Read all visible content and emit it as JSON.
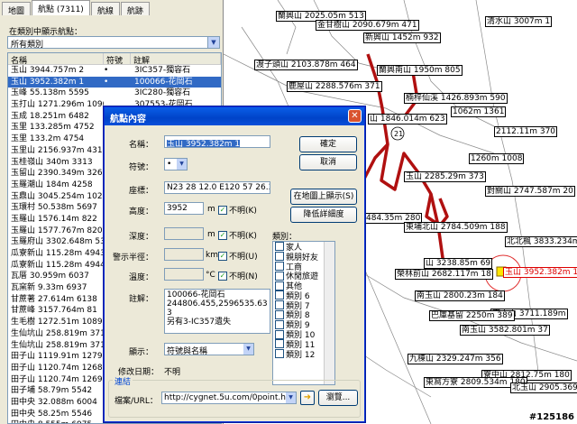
{
  "left_panel": {
    "tabs": [
      "地圖",
      "航點 (7311)",
      "航線",
      "航跡"
    ],
    "filter_label": "在類別中顯示航點：",
    "filter_value": "所有類別",
    "columns": [
      "名稱",
      "符號",
      "註解"
    ],
    "rows": [
      {
        "name": "玉山 3944.757m 2",
        "sym": "•",
        "note": "3IC357-獨容石"
      },
      {
        "name": "玉山 3952.382m 1",
        "sym": "•",
        "note": "100066-花岡石",
        "selected": true
      },
      {
        "name": "玉峰 55.138m 5595",
        "sym": "",
        "note": "3IC280-獨容石"
      },
      {
        "name": "玉打山 1271.296m 1090",
        "sym": "",
        "note": "307553-花岡石"
      },
      {
        "name": "玉成 18.251m 6482",
        "sym": "",
        "note": ""
      },
      {
        "name": "玉里 133.285m 4752",
        "sym": "",
        "note": ""
      },
      {
        "name": "玉里 133.2m 4754",
        "sym": "",
        "note": ""
      },
      {
        "name": "玉里山 2156.937m 431",
        "sym": "",
        "note": ""
      },
      {
        "name": "玉桂嶺山 340m 3313",
        "sym": "",
        "note": ""
      },
      {
        "name": "玉留山 2390.349m 326",
        "sym": "",
        "note": ""
      },
      {
        "name": "玉羅潮山 184m 4258",
        "sym": "",
        "note": ""
      },
      {
        "name": "玉鼎山 3045.254m 102",
        "sym": "",
        "note": ""
      },
      {
        "name": "玉環村 50.538m 5697",
        "sym": "",
        "note": ""
      },
      {
        "name": "玉羅山 1576.14m 822",
        "sym": "",
        "note": ""
      },
      {
        "name": "玉羅山 1577.767m 820",
        "sym": "",
        "note": ""
      },
      {
        "name": "玉羅府山 3302.648m 53",
        "sym": "",
        "note": ""
      },
      {
        "name": "瓜寮新山 115.28m 4943",
        "sym": "",
        "note": ""
      },
      {
        "name": "瓜寮新山 115.28m 4944",
        "sym": "",
        "note": ""
      },
      {
        "name": "瓦厝 30.959m 6037",
        "sym": "",
        "note": ""
      },
      {
        "name": "瓦窯新 9.33m 6937",
        "sym": "",
        "note": ""
      },
      {
        "name": "甘蔗著 27.614m 6138",
        "sym": "",
        "note": ""
      },
      {
        "name": "甘蔗峰 3157.764m 81",
        "sym": "",
        "note": ""
      },
      {
        "name": "生毛樹 1272.51m 1089",
        "sym": "",
        "note": ""
      },
      {
        "name": "生仙坑山 258.819m 3713",
        "sym": "",
        "note": ""
      },
      {
        "name": "生仙坑山 258.819m 3714",
        "sym": "",
        "note": ""
      },
      {
        "name": "田子山 1119.91m 1279",
        "sym": "",
        "note": ""
      },
      {
        "name": "田子山 1120.74m 1268",
        "sym": "",
        "note": ""
      },
      {
        "name": "田子山 1120.74m 1269",
        "sym": "",
        "note": ""
      },
      {
        "name": "田子埔 58.79m 5542",
        "sym": "",
        "note": ""
      },
      {
        "name": "田中央 32.088m 6004",
        "sym": "",
        "note": ""
      },
      {
        "name": "田中央 58.25m 5546",
        "sym": "",
        "note": ""
      },
      {
        "name": "田中央 8.555m 6975",
        "sym": "",
        "note": ""
      },
      {
        "name": "田中山 820m 1793",
        "sym": "",
        "note": ""
      }
    ]
  },
  "dialog": {
    "title": "航點內容",
    "close": "✕",
    "name_label": "名稱：",
    "name_value": "玉山 3952.382m 1",
    "symbol_label": "符號：",
    "symbol_value": "•",
    "coord_label": "座標：",
    "coord_value": "N23 28 12.0 E120 57 26.3",
    "alt_label": "高度：",
    "alt_value": "3952",
    "alt_unit": "m",
    "depth_label": "深度：",
    "depth_unit": "m",
    "radius_label": "警示半徑：",
    "radius_unit": "km",
    "temp_label": "溫度：",
    "temp_unit": "°C",
    "unknown": "不明(K)",
    "unknown2": "不明(U)",
    "unknown3": "不明(N)",
    "comment_label": "註解：",
    "comment_lines": [
      "100066-花岡石",
      "244806.455,2596535.63",
      "3",
      "另有3-IC357遺失"
    ],
    "display_label": "顯示：",
    "display_value": "符號與名稱",
    "modified_label": "修改日期：",
    "modified_value": "不明",
    "ok": "確定",
    "cancel": "取消",
    "show_on_map": "在地圖上顯示(S)",
    "lower_detail": "降低詳細度",
    "category_label": "類別：",
    "categories": [
      "家人",
      "親朋好友",
      "工商",
      "休閒旅遊",
      "其他",
      "類別 6",
      "類別 7",
      "類別 8",
      "類別 9",
      "類別 10",
      "類別 11",
      "類別 12"
    ],
    "link_group": "連結",
    "link_label": "檔案/URL：",
    "link_value": "http://cygnet.5u.com/0point.htm",
    "browse": "瀏覽..."
  },
  "map": {
    "labels": [
      "蘭興山 2025.05m 513",
      "金甘樹山 2090.679m 471",
      "新興山 1452m 932",
      "清水山 3007m 1",
      "渡子頭山 2103.878m 464",
      "蘭興南山 1950m 805",
      "鹿屋山 2288.576m 371",
      "楠梓仙溪 1426.893m 590",
      "山 1846.014m 623",
      "1062m 1361",
      "2112.11m 370",
      "1260m 1008",
      "玉山 2285.29m 373",
      "對關山 2747.587m 20",
      "484.35m 280",
      "東埔北山 2784.509m 188",
      "北北楓 3833.234m",
      "山 3238.85m 69",
      "玉山 3952.382m 1",
      "榮林前山 2682.117m 18",
      "南玉山 2800.23m 184",
      "東大山 3711.189m",
      "巴庫基留 2250m 389",
      "南玉山 3582.801m 37",
      "九棟山 2329.247m 356",
      "寮中山 2812.75m 180",
      "東窩方寮 2809.534m 180",
      "北玉山 2905.369m"
    ],
    "watermark": "#125186"
  }
}
